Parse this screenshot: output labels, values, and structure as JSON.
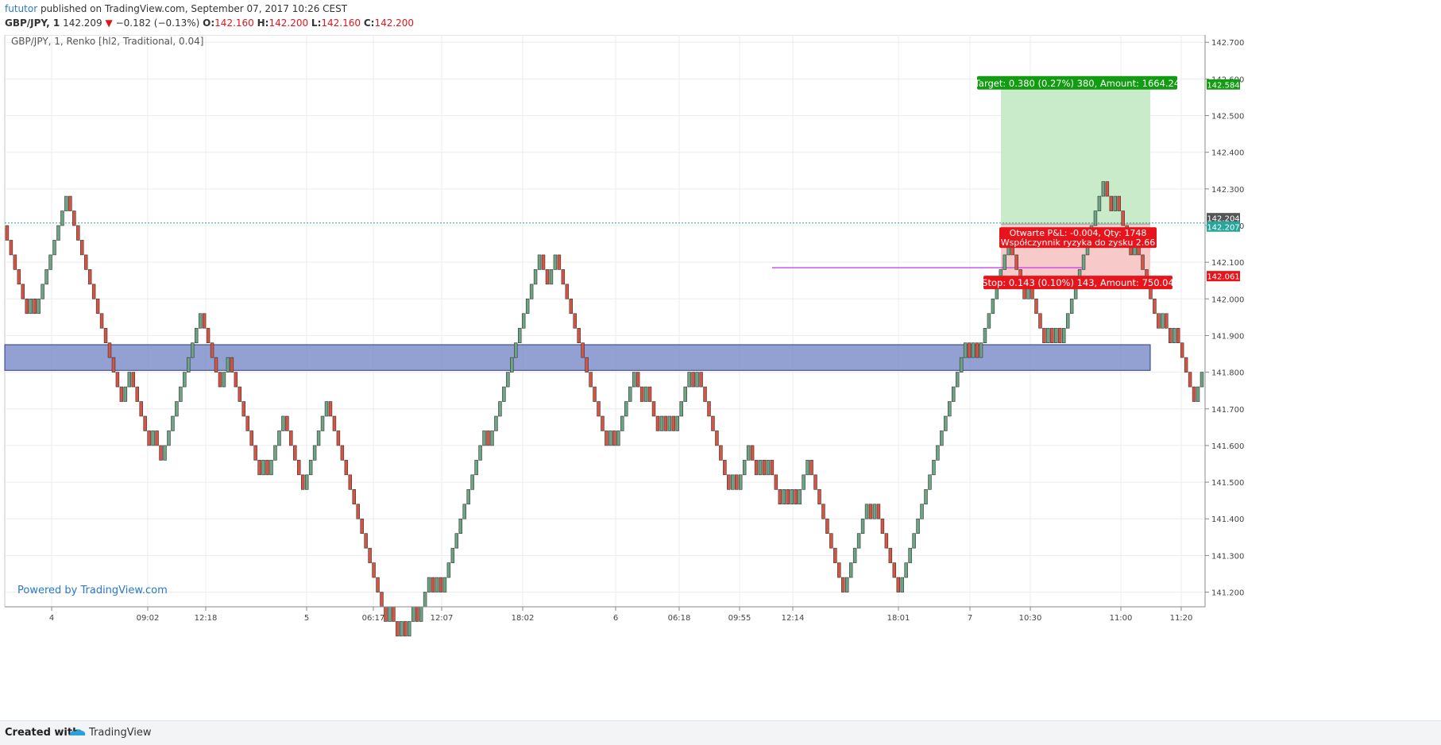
{
  "header": {
    "author": "fututor",
    "published": " published on TradingView.com, September 07, 2017 10:26 CEST",
    "symbol": "GBP/JPY, 1",
    "last": "142.209",
    "change_arrow": "▼",
    "change": "−0.182 (−0.13%)",
    "o_label": "O:",
    "o_val": "142.160",
    "h_label": "H:",
    "h_val": "142.200",
    "l_label": "L:",
    "l_val": "142.160",
    "c_label": "C:",
    "c_val": "142.200"
  },
  "chart_data": {
    "type": "renko",
    "title": "GBP/JPY, 1, Renko [hl2, Traditional, 0.04]",
    "brick_size": 0.04,
    "ylim": [
      141.16,
      142.72
    ],
    "y_ticks": [
      "142.700",
      "142.600",
      "142.500",
      "142.400",
      "142.300",
      "142.200",
      "142.100",
      "142.000",
      "141.900",
      "141.800",
      "141.700",
      "141.600",
      "141.500",
      "141.400",
      "141.300",
      "141.200"
    ],
    "x_tick_labels": [
      "4",
      "09:02",
      "12:18",
      "5",
      "06:17",
      "12:07",
      "18:02",
      "6",
      "06:18",
      "09:55",
      "12:14",
      "18:01",
      "7",
      "10:30",
      "11:00",
      "11:20"
    ],
    "price_labels": [
      "142.584",
      "142.204",
      "142.207",
      "142.061"
    ],
    "support_zone": [
      141.805,
      141.875
    ],
    "level_line": 142.085,
    "current_price": 142.207,
    "position": {
      "entry": 142.204,
      "target_price": 142.584,
      "stop_price": 142.061,
      "target_label": "Target: 0.380 (0.27%) 380, Amount: 1664.24",
      "stop_label": "Stop: 0.143 (0.10%) 143, Amount: 750.04",
      "pnl_label": "Otwarte P&L: -0.004, Qty: 1748",
      "ratio_label": "Współczynnik ryzyka do zysku 2.66"
    },
    "bricks_start": 142.2,
    "bricks": "DDDDDDUDUUUUUUUUDDDDDDDDDDDDDDUUDDDDDUDDUUUUUUUUUUDDDDDUUDDDDDDDDUDUUUUDDDDDUUUUUUDDDDDDDDDDDDDDDUDDUDUUDUUUDUDUUUUUUUUUUUDUUUUUUUUUUUUUDDUUDDDDDDDDDDDDDUDUUUUUDDUDDDUDUDUUUUDUDDDDDDDDUDUUUDDUDUDDDUDUDUUUDDDDDDDDDUUUUUUDUDDDDDDUUUUUUUUUUUUUUUUUDUDUUUUUUUUDDDDUDDDDUDUDUUUUUUUUUUUDDUDDDDUDDDDDDUDDUDDDDDUU"
  },
  "watermark": "Powered by TradingView.com",
  "footer": {
    "created": "Created with",
    "brand": "TradingView"
  },
  "colors": {
    "up": "#6ba583",
    "down": "#d75442",
    "border": "#333333",
    "zone": "#7f8fca",
    "level": "#c846e6",
    "current": "#26a69a",
    "target_fill": "#c9ebc9",
    "stop_fill": "#f8c9c9",
    "target_label": "#119c11",
    "stop_label": "#e8141b"
  }
}
